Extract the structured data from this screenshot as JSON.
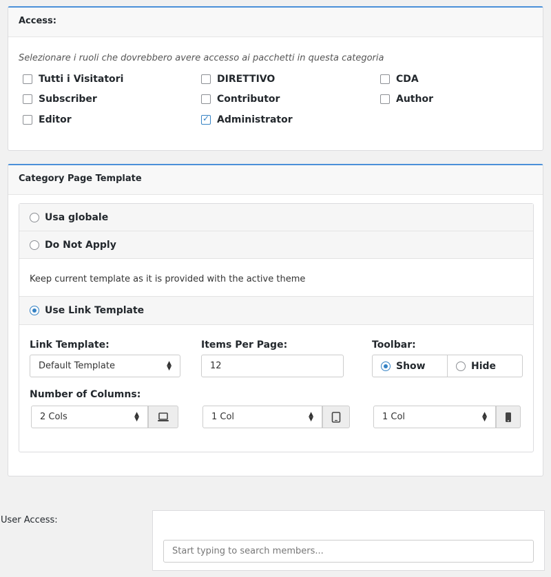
{
  "access": {
    "title": "Access:",
    "hint": "Selezionare i ruoli che dovrebbero avere accesso ai pacchetti in questa categoria",
    "roles": [
      {
        "label": "Tutti i Visitatori",
        "checked": false
      },
      {
        "label": "DIRETTIVO",
        "checked": false
      },
      {
        "label": "CDA",
        "checked": false
      },
      {
        "label": "Subscriber",
        "checked": false
      },
      {
        "label": "Contributor",
        "checked": false
      },
      {
        "label": "Author",
        "checked": false
      },
      {
        "label": "Editor",
        "checked": false
      },
      {
        "label": "Administrator",
        "checked": true
      }
    ]
  },
  "template": {
    "title": "Category Page Template",
    "options": [
      {
        "label": "Usa globale",
        "selected": false
      },
      {
        "label": "Do Not Apply",
        "selected": false
      },
      {
        "label": "Use Link Template",
        "selected": true
      }
    ],
    "do_not_apply_desc": "Keep current template as it is provided with the active theme",
    "link_template_label": "Link Template:",
    "link_template_value": "Default Template",
    "items_per_page_label": "Items Per Page:",
    "items_per_page_value": "12",
    "toolbar_label": "Toolbar:",
    "toolbar_show": "Show",
    "toolbar_hide": "Hide",
    "toolbar_selected": "Show",
    "columns_label": "Number of Columns:",
    "columns": [
      {
        "value": "2 Cols",
        "device": "desktop-icon"
      },
      {
        "value": "1 Col",
        "device": "tablet-icon"
      },
      {
        "value": "1 Col",
        "device": "mobile-icon"
      }
    ]
  },
  "user_access": {
    "label": "User Access:",
    "placeholder": "Start typing to search members..."
  },
  "colors": {
    "accent": "#3582c4",
    "panel_top": "#4a90d9"
  }
}
